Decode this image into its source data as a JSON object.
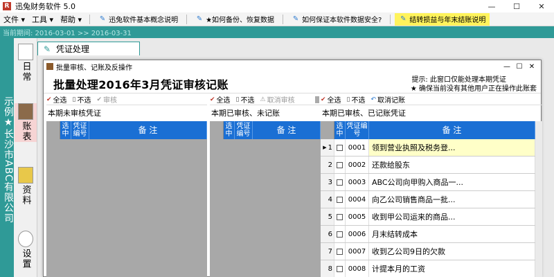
{
  "window": {
    "title": "迅兔财务软件 5.0",
    "logo_text": "R",
    "minimize": "—",
    "maximize": "☐",
    "close": "✕"
  },
  "menu": {
    "file": "文件 ▾",
    "tools": "工具 ▾",
    "help": "帮助 ▾",
    "tool1": "迅兔软件基本概念说明",
    "tool2": "★如何备份、恢复数据",
    "tool3": "如何保证本软件数据安全?",
    "tool4": "结转损益与年末结账说明"
  },
  "datebar": {
    "text": "当前期间: 2016-03-01 >> 2016-03-31"
  },
  "sidebar": {
    "company": "示例★长沙市ABC有限公司",
    "items": [
      {
        "label": "日常"
      },
      {
        "label": "账表"
      },
      {
        "label": "资料"
      },
      {
        "label": "设置"
      }
    ],
    "voucher_tab": "凭证处理"
  },
  "dialog": {
    "title": "批量审核、记账及反操作",
    "min": "—",
    "max": "☐",
    "close": "✕",
    "heading": "批量处理2016年3月凭证审核记账",
    "hint1": "提示: 此窗口仅能处理本期凭证",
    "hint2": "★ 确保当前没有其他用户正在操作此账套"
  },
  "panel1": {
    "select_all": "全选",
    "deselect": "不选",
    "action": "审核",
    "label": "本期未审核凭证",
    "col_select": "选中",
    "col_code": "凭证编号",
    "col_memo": "备 注"
  },
  "panel2": {
    "select_all": "全选",
    "deselect": "不选",
    "action": "取消审核",
    "label": "本期已审核、未记账",
    "col_select": "选中",
    "col_code": "凭证编号",
    "col_memo": "备 注"
  },
  "panel3": {
    "select_all": "全选",
    "deselect": "不选",
    "action": "取消记账",
    "label": "本期已审核、已记账凭证",
    "col_select": "选中",
    "col_code": "凭证编号",
    "col_memo": "备 注",
    "rows": [
      {
        "num": "1",
        "code": "0001",
        "memo": "领到营业执照及税务登..."
      },
      {
        "num": "2",
        "code": "0002",
        "memo": "还款给股东"
      },
      {
        "num": "3",
        "code": "0003",
        "memo": "ABC公司向甲购入商品一..."
      },
      {
        "num": "4",
        "code": "0004",
        "memo": "向乙公司销售商品一批..."
      },
      {
        "num": "5",
        "code": "0005",
        "memo": "收到甲公司运来的商品..."
      },
      {
        "num": "6",
        "code": "0006",
        "memo": "月末结转成本"
      },
      {
        "num": "7",
        "code": "0007",
        "memo": "收到乙公司9日的欠款"
      },
      {
        "num": "8",
        "code": "0008",
        "memo": "计提本月的工资"
      }
    ]
  }
}
